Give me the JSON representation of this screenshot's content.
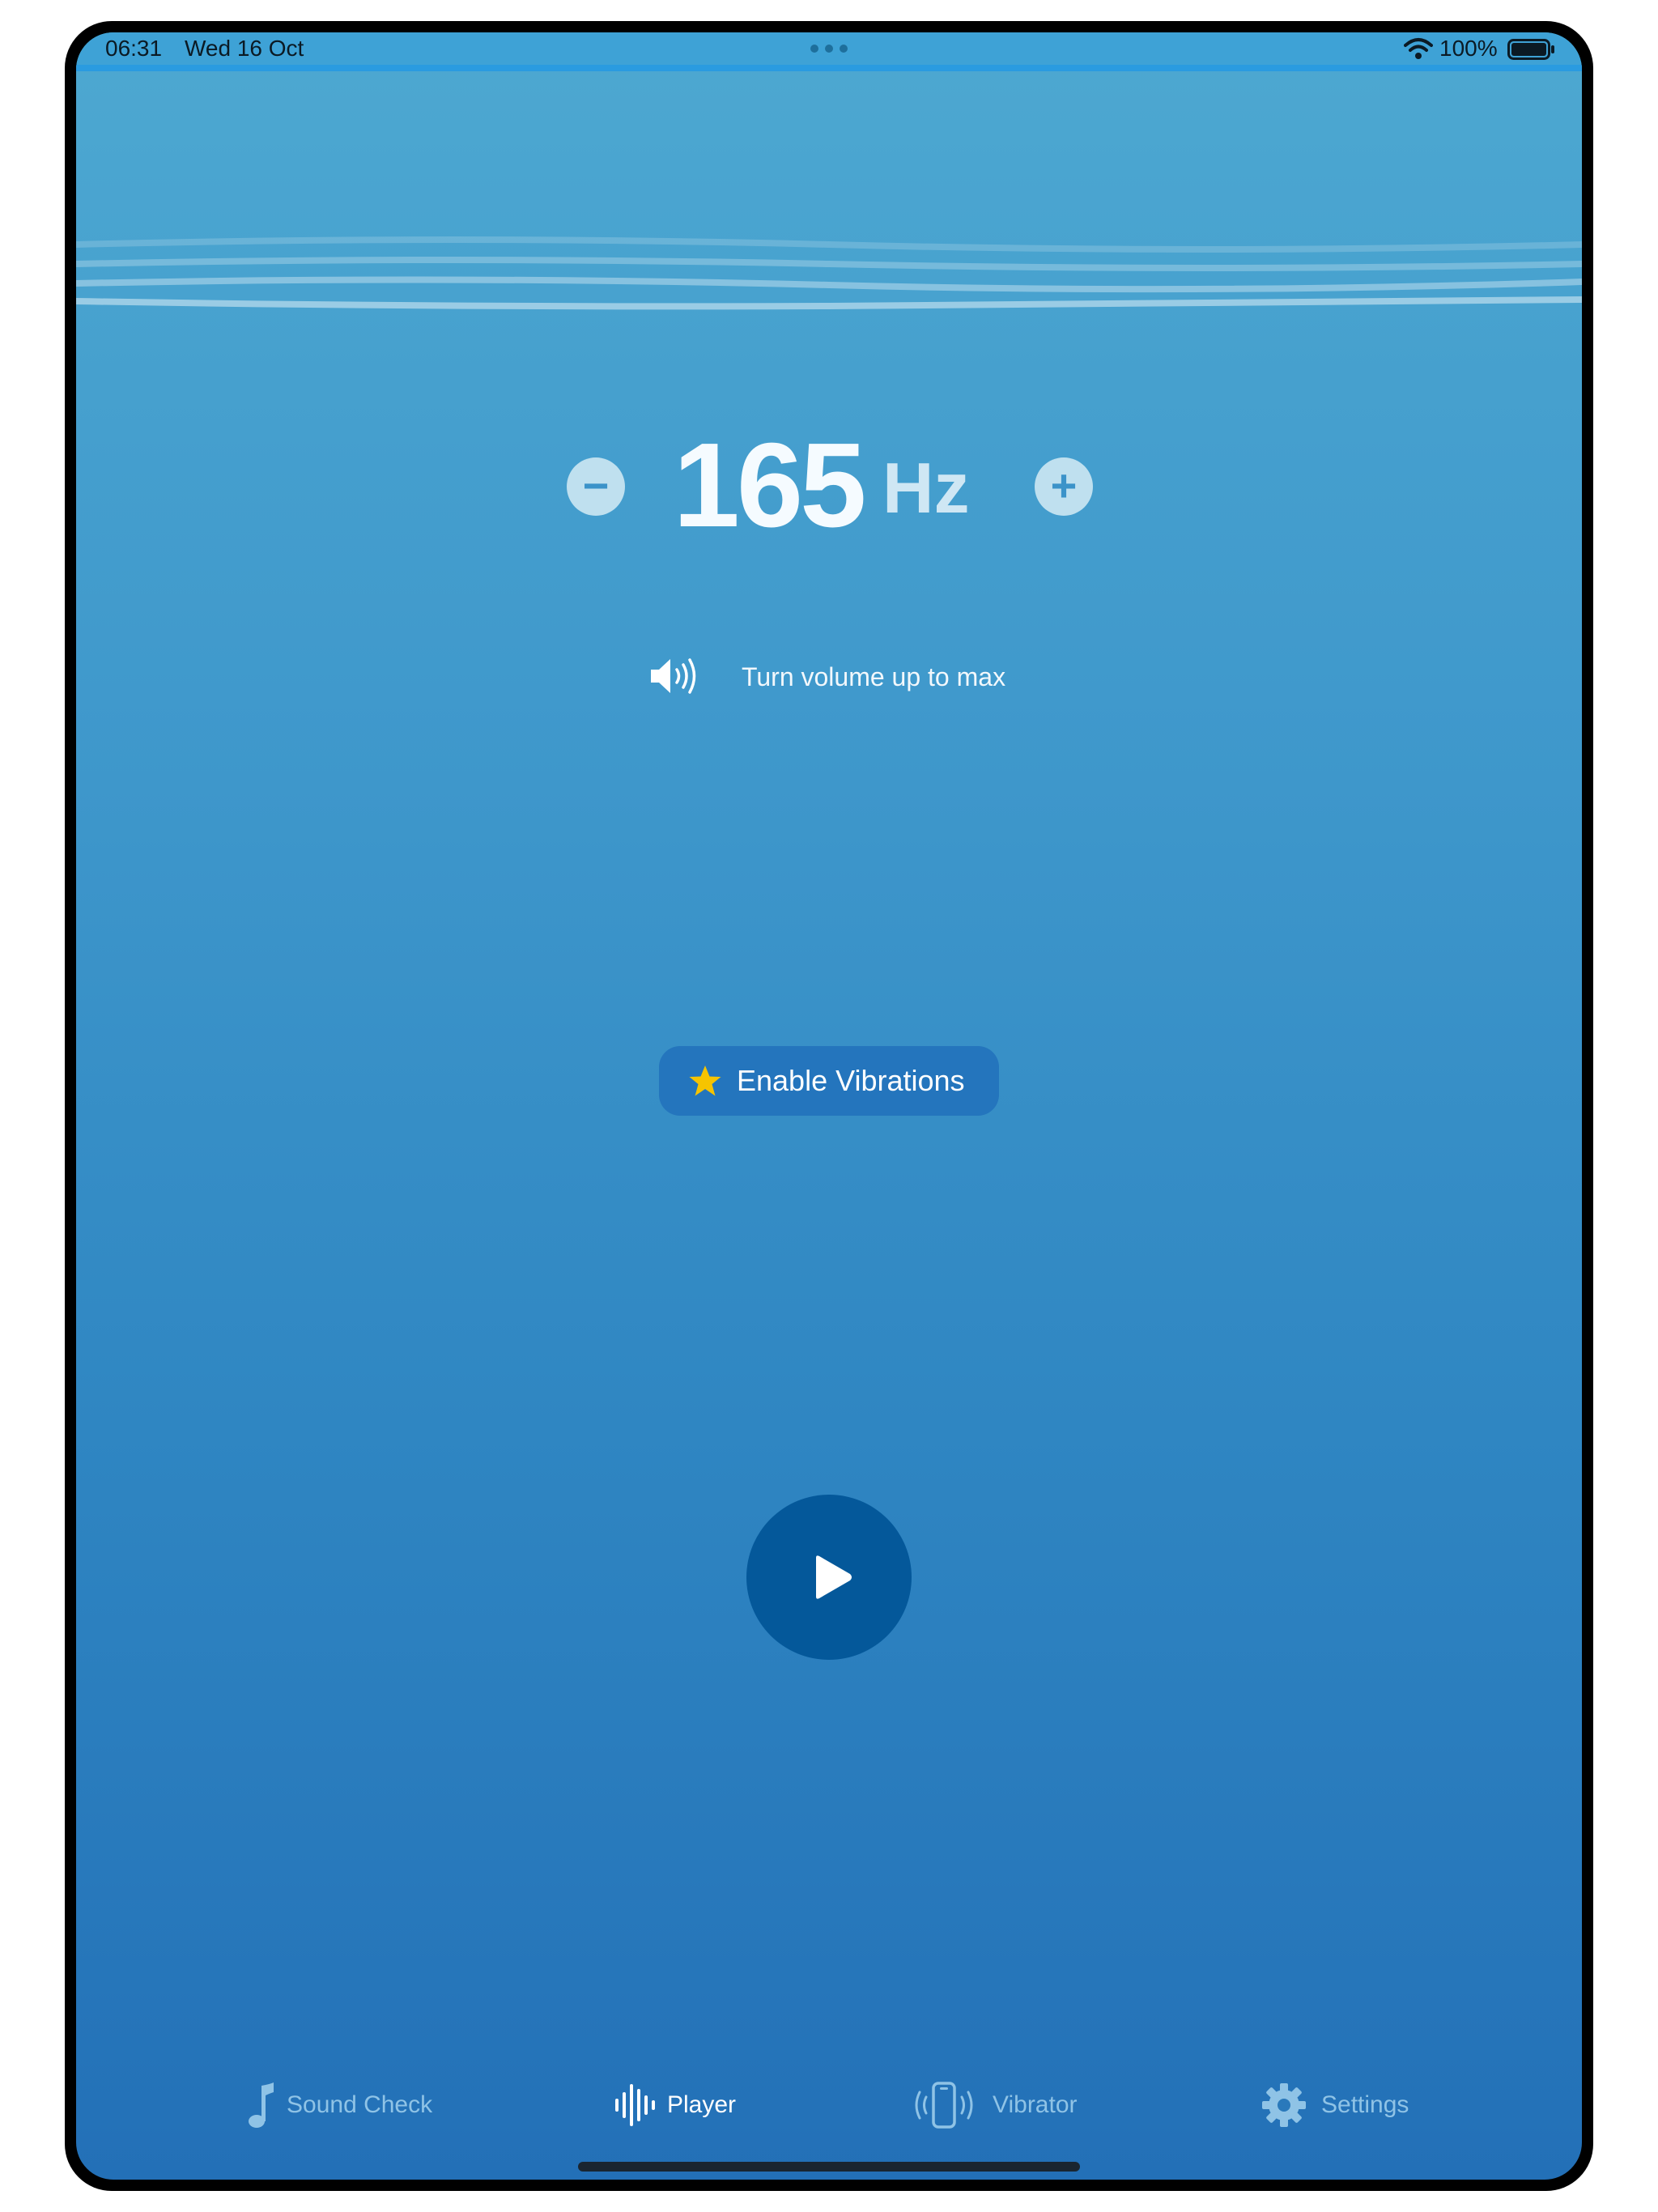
{
  "status_bar": {
    "time": "06:31",
    "date": "Wed 16 Oct",
    "battery": "100%",
    "icons": [
      "multitasking-dots-icon",
      "wifi-icon",
      "battery-icon"
    ]
  },
  "frequency": {
    "value": "165",
    "unit": "Hz",
    "decrease_symbol": "−",
    "increase_symbol": "+"
  },
  "volume_hint": {
    "icon": "speaker-volume-icon",
    "text": "Turn volume up to max"
  },
  "enable_button": {
    "icon": "star-icon",
    "label": "Enable Vibrations"
  },
  "player": {
    "icon": "play-icon"
  },
  "tab_bar": {
    "items": [
      {
        "label": "Sound Check",
        "icon": "music-note-icon",
        "active": false
      },
      {
        "label": "Player",
        "icon": "waveform-icon",
        "active": true
      },
      {
        "label": "Vibrator",
        "icon": "phone-vibrate-icon",
        "active": false
      },
      {
        "label": "Settings",
        "icon": "gear-icon",
        "active": false
      }
    ]
  },
  "colors": {
    "background_top": "#4da8d1",
    "background_bottom": "#2370b7",
    "enable_button": "#2475bd",
    "play_button": "#04589a",
    "star": "#f6c400",
    "tab_inactive": "#8fc3e6",
    "tab_active": "#ffffff"
  }
}
